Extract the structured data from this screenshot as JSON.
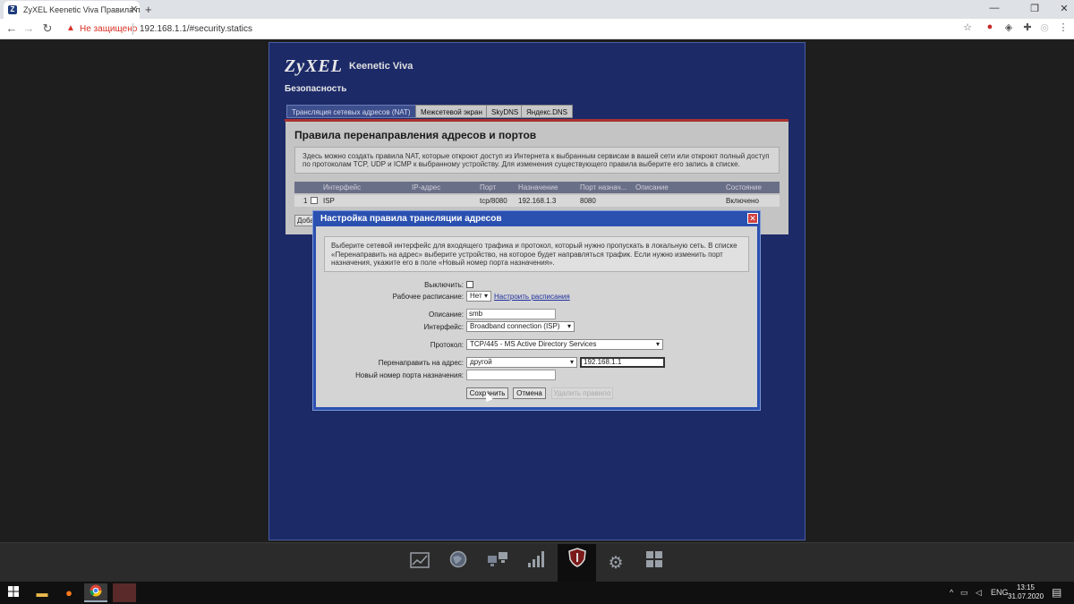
{
  "browser": {
    "tab_title": "ZyXEL Keenetic Viva Правила пе",
    "favicon_letter": "Z",
    "tab_close": "✕",
    "new_tab": "+",
    "security_label": "Не защищено",
    "url": "192.168.1.1/#security.statics"
  },
  "router": {
    "logo": "ZyXEL",
    "model": "Keenetic Viva",
    "section": "Безопасность",
    "tabs": [
      {
        "label": "Трансляция сетевых адресов (NAT)",
        "active": true
      },
      {
        "label": "Межсетевой экран",
        "active": false
      },
      {
        "label": "SkyDNS",
        "active": false
      },
      {
        "label": "Яндекс.DNS",
        "active": false
      }
    ],
    "panel_title": "Правила перенаправления адресов и портов",
    "panel_info": "Здесь можно создать правила NAT, которые откроют доступ из Интернета к выбранным сервисам в вашей сети или откроют полный доступ по протоколам TCP, UDP и ICMP к выбранному устройству. Для изменения существующего правила выберите его запись в списке.",
    "columns": [
      "Интерфейс",
      "IP-адрес",
      "Порт",
      "Назначение",
      "Порт назнач...",
      "Описание",
      "Состояние"
    ],
    "rows": [
      {
        "num": "1",
        "interface": "ISP",
        "ip": "",
        "port": "tcp/8080",
        "dest": "192.168.1.3",
        "dest_port": "8080",
        "desc": "",
        "state": "Включено"
      }
    ],
    "add_button": "Добавить"
  },
  "dialog": {
    "title": "Настройка правила трансляции адресов",
    "close": "✕",
    "info": "Выберите сетевой интерфейс для входящего трафика и протокол, который нужно пропускать в локальную сеть. В списке «Перенаправить на адрес» выберите устройство, на которое будет направляться трафик. Если нужно изменить порт назначения, укажите его в поле «Новый номер порта назначения».",
    "disable_label": "Выключить:",
    "schedule_label": "Рабочее расписание:",
    "schedule_value": "Нет",
    "schedule_link": "Настроить расписания",
    "description_label": "Описание:",
    "description_value": "smb",
    "interface_label": "Интерфейс:",
    "interface_value": "Broadband connection (ISP)",
    "protocol_label": "Протокол:",
    "protocol_value": "TCP/445 - MS Active Directory Services",
    "redirect_label": "Перенаправить на адрес:",
    "redirect_value": "другой",
    "redirect_ip": "192.168.1.1",
    "new_port_label": "Новый номер порта назначения:",
    "new_port_value": "",
    "save_button": "Сохранить",
    "cancel_button": "Отмена",
    "delete_button": "Удалить правило"
  },
  "dock": {
    "items": [
      "chart-icon",
      "globe-icon",
      "network-icon",
      "signal-icon",
      "shield-icon",
      "gear-icon",
      "apps-icon"
    ],
    "active_index": 4
  },
  "taskbar": {
    "lang": "ENG",
    "time": "13:15",
    "date": "31.07.2020"
  }
}
